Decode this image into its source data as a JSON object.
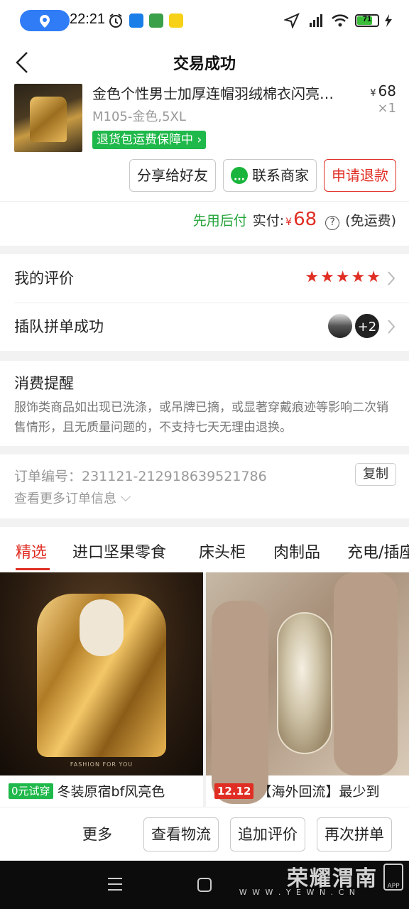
{
  "status_bar": {
    "time": "22:21",
    "battery": "71",
    "location_icon": "location-pin-icon",
    "alarm_icon": "alarm-clock-icon"
  },
  "nav": {
    "title": "交易成功"
  },
  "product": {
    "title": "金色个性男士加厚连帽羽绒棉衣闪亮…",
    "price_currency": "¥",
    "price": "68",
    "spec": "M105-金色,5XL",
    "qty": "×1",
    "guarantee_tag": "退货包运费保障中",
    "buttons": {
      "share": "分享给好友",
      "contact": "联系商家",
      "refund": "申请退款"
    },
    "pay": {
      "label_green": "先用后付",
      "label": "实付:",
      "currency": "¥",
      "amount": "68",
      "shipping": "(免运费)"
    }
  },
  "review": {
    "label": "我的评价",
    "stars": 5,
    "group_label": "插队拼单成功",
    "group_more": "+2"
  },
  "notice": {
    "title": "消费提醒",
    "body": "服饰类商品如出现已洗涤，或吊牌已摘，或显著穿戴痕迹等影响二次销售情形，且无质量问题的，不支持七天无理由退换。"
  },
  "order": {
    "number": "订单编号：231121-212918639521786",
    "copy": "复制",
    "more_info": "查看更多订单信息"
  },
  "tabs": [
    "精选",
    "进口坚果零食",
    "床头柜",
    "肉制品",
    "充电/插座"
  ],
  "grid": [
    {
      "badge": "0元试穿",
      "badge_color": "#1fb84a",
      "title": "冬装原宿bf风亮色",
      "caption": "FASHION FOR YOU"
    },
    {
      "badge": "12.12",
      "badge_color": "#e02e24",
      "title": "【海外回流】最少到"
    }
  ],
  "bottom": {
    "more": "更多",
    "logistics": "查看物流",
    "add_review": "追加评价",
    "regroup": "再次拼单"
  },
  "watermark": {
    "main": "荣耀渭南",
    "sub": "W W W . Y E W N . C N",
    "app": "APP"
  },
  "colors": {
    "accent_red": "#e02e24",
    "green": "#1fb84a",
    "status_blue": "#2f7cf6"
  }
}
